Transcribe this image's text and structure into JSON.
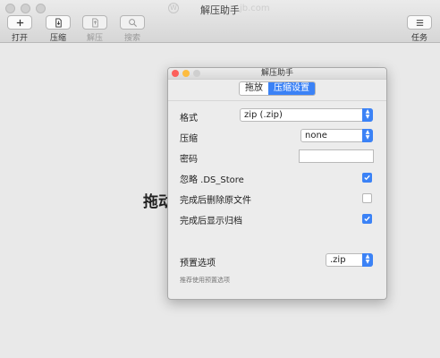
{
  "main": {
    "title": "解压助手",
    "watermark_logo": "W",
    "watermark": "jb.com",
    "toolbar": {
      "open": "打开",
      "compress": "压缩",
      "extract": "解压",
      "search": "搜索",
      "tasks": "任务"
    },
    "drop_text": "拖动"
  },
  "prefs": {
    "title": "解压助手",
    "tabs": [
      {
        "label": "拖放",
        "active": false
      },
      {
        "label": "压缩设置",
        "active": true
      }
    ],
    "format": {
      "label": "格式",
      "value": "zip (.zip)"
    },
    "compression": {
      "label": "压缩",
      "value": "none"
    },
    "password": {
      "label": "密码",
      "value": ""
    },
    "ignore_ds_store": {
      "label": "忽略 .DS_Store",
      "checked": true
    },
    "delete_after": {
      "label": "完成后删除原文件",
      "checked": false
    },
    "show_archive": {
      "label": "完成后显示归档",
      "checked": true
    },
    "preset": {
      "label": "预置选项",
      "value": ".zip"
    },
    "hint": "推荐使用预置选项"
  },
  "colors": {
    "accent": "#3b82f6",
    "close": "#fc605c",
    "minimize": "#fdbc40"
  }
}
